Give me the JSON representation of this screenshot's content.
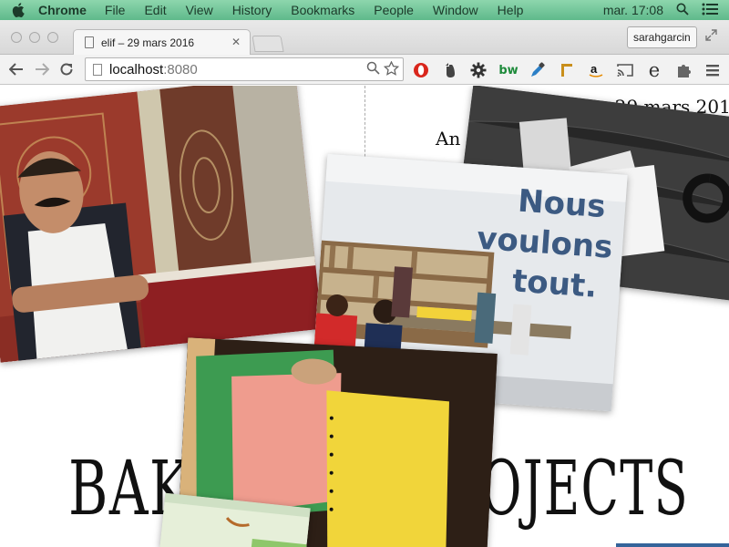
{
  "menubar": {
    "app_name": "Chrome",
    "items": [
      "File",
      "Edit",
      "View",
      "History",
      "Bookmarks",
      "People",
      "Window",
      "Help"
    ],
    "clock": "mar. 17:08"
  },
  "tab": {
    "title": "elif – 29 mars 2016"
  },
  "profile": {
    "name": "sarahgarcin"
  },
  "address": {
    "host": "localhost",
    "port": ":8080"
  },
  "page": {
    "title_fragment": "elif – 29 mars 2016",
    "subtitle_fragment": "An",
    "big_left": "BAK",
    "big_right": "OJECTS",
    "poster_text": [
      "Nous",
      "voulons",
      "tout."
    ]
  },
  "colors": {
    "menubar": "#7acb9f",
    "poster_blue": "#3c5a82",
    "paper_pink": "#ef9c8e",
    "paper_yellow": "#f1d53a",
    "paper_green": "#3d9b51"
  }
}
